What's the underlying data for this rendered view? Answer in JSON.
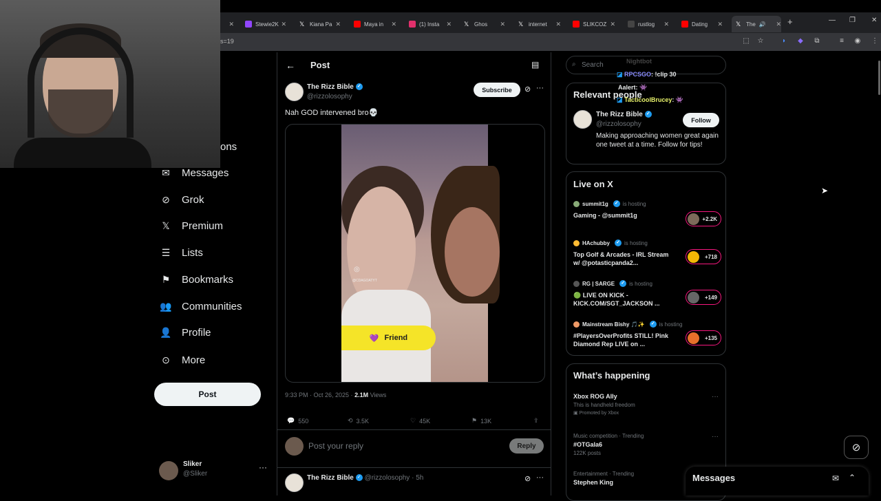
{
  "browser": {
    "tabs": [
      {
        "label": "Stewie2K",
        "color": "#9146ff"
      },
      {
        "label": "Kiana Pa",
        "color": "#ffffff"
      },
      {
        "label": "Maya in",
        "color": "#ff0000"
      },
      {
        "label": "(1) Insta",
        "color": "#e1306c"
      },
      {
        "label": "Ghos",
        "color": "#ffffff"
      },
      {
        "label": "internet",
        "color": "#ffffff"
      },
      {
        "label": "SLIKCOZ",
        "color": "#ff0000"
      },
      {
        "label": "rustlog",
        "color": "#444444"
      },
      {
        "label": "Dating",
        "color": "#ff0000"
      },
      {
        "label": "The",
        "color": "#ffffff"
      }
    ],
    "url": "s=19"
  },
  "nav": {
    "partial_label": "ons",
    "items": [
      {
        "label": "Messages",
        "icon": "mail-icon"
      },
      {
        "label": "Grok",
        "icon": "grok-icon"
      },
      {
        "label": "Premium",
        "icon": "x-logo-icon"
      },
      {
        "label": "Lists",
        "icon": "list-icon"
      },
      {
        "label": "Bookmarks",
        "icon": "bookmark-icon"
      },
      {
        "label": "Communities",
        "icon": "communities-icon"
      },
      {
        "label": "Profile",
        "icon": "person-icon"
      },
      {
        "label": "More",
        "icon": "more-circle-icon"
      }
    ],
    "post_button": "Post",
    "account": {
      "name": "Sliker",
      "handle": "@Sliker"
    }
  },
  "post": {
    "header": "Post",
    "author": "The Rizz Bible",
    "handle": "@rizzolosophy",
    "subscribe": "Subscribe",
    "text": "Nah GOD intervened bro💀",
    "video_watermark": "@CDAGOATYT",
    "friend_label": "Friend",
    "time": "9:33 PM · Oct 26, 2025 · ",
    "views_count": "2.1M",
    "views_label": " Views",
    "replies": "550",
    "reposts": "3.5K",
    "likes": "45K",
    "bookmarks": "13K",
    "reply_placeholder": "Post your reply",
    "reply_button": "Reply",
    "next_author": "The Rizz Bible",
    "next_meta": "@rizzolosophy · 5h"
  },
  "sidebar": {
    "search_placeholder": "Search",
    "relevant": {
      "title": "Relevant people",
      "name": "The Rizz Bible",
      "handle": "@rizzolosophy",
      "follow": "Follow",
      "bio": "Making approaching women great again one tweet at a time. Follow for tips!"
    },
    "live": {
      "title": "Live on X",
      "hosting_label": "is hosting",
      "rows": [
        {
          "host": "summit1g",
          "title": "Gaming - @summit1g",
          "count": "+2.2K"
        },
        {
          "host": "HAchubby",
          "title": "Top Golf & Arcades - IRL Stream w/ @potasticpanda2...",
          "count": "+718"
        },
        {
          "host": "RG | SARGE",
          "title": "🟢 LIVE ON KICK - KICK.COM/SGT_JACKSON ...",
          "count": "+149"
        },
        {
          "host": "Mainstream Bishy 🎵✨",
          "title": "#PlayersOverProfits STILL! Pink Diamond Rep LIVE on ...",
          "count": "+135"
        }
      ]
    },
    "happening": {
      "title": "What’s happening",
      "items": [
        {
          "context": "",
          "title": "Xbox ROG Ally",
          "sub": "This is handheld freedom",
          "sub2": "Promoted by Xbox"
        },
        {
          "context": "Music competition · Trending",
          "title": "#OTGala6",
          "sub": "122K posts",
          "sub2": ""
        },
        {
          "context": "Entertainment · Trending",
          "title": "Stephen King",
          "sub": "",
          "sub2": ""
        }
      ]
    }
  },
  "messages_drawer": {
    "title": "Messages"
  },
  "stream_chat": [
    {
      "name": "Nightbot",
      "msg": ""
    },
    {
      "name": "RPCSGO",
      "msg": ": !clip 30"
    },
    {
      "name": "Aalert",
      "msg": ":"
    },
    {
      "name": "TacticoolBrucey",
      "msg": ":"
    }
  ]
}
